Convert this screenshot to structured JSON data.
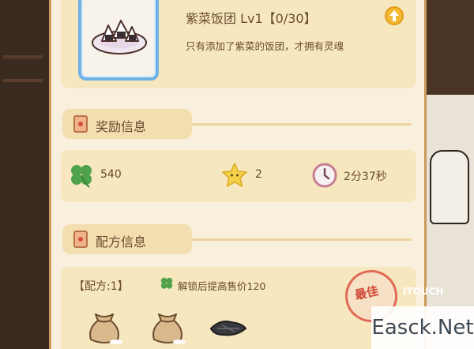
{
  "item": {
    "title": "紫菜饭团 Lv1【0/30】",
    "description": "只有添加了紫菜的饭团，才拥有灵魂"
  },
  "reward_section": {
    "label": "奖励信息",
    "clover_value": "540",
    "star_value": "2",
    "time_value": "2分37秒"
  },
  "recipe_section": {
    "label": "配方信息",
    "recipe_label": "【配方:1】",
    "unlock_text": "解锁后提高售价120",
    "stamp_text": "最佳"
  },
  "watermark": {
    "small": "ITOUCH",
    "main": "Easck.Net"
  },
  "colors": {
    "panel": "#f8f0dd",
    "box": "#f6e7bf",
    "frame": "#6fb1e4",
    "text": "#6b4a2e"
  }
}
